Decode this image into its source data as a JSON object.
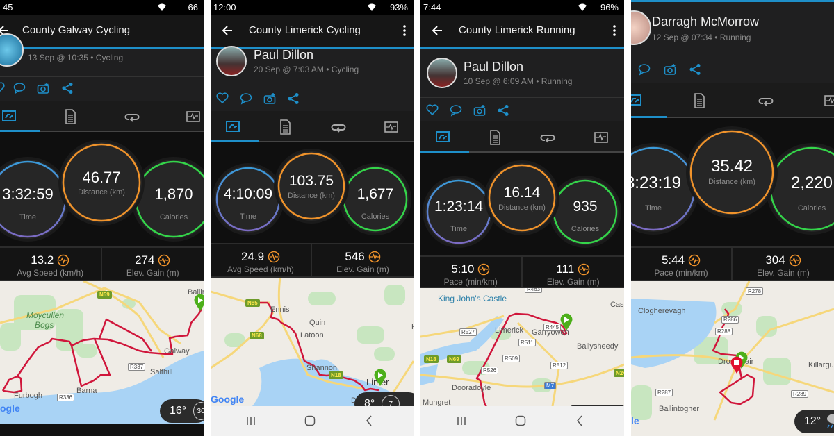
{
  "colors": {
    "accent": "#1e8fc9",
    "time_ring_top": "#3a9ad9",
    "time_ring_bottom": "#7c6bc4",
    "distance_ring": "#f0932b",
    "calories_ring": "#34d54a",
    "route": "#d0163b",
    "start_pin": "#4caf1a",
    "end_pin": "#e0102e"
  },
  "panels": [
    {
      "status": {
        "time": "45",
        "battery": "66"
      },
      "toolbar": {
        "title": "County Galway Cycling"
      },
      "profile": {
        "name": "",
        "subtitle": "13 Sep @ 10:35 • Cycling"
      },
      "tabs": [
        "summary-icon",
        "details-icon",
        "laps-icon",
        "charts-icon"
      ],
      "circles": [
        {
          "value": "3:32:59",
          "label": "Time"
        },
        {
          "value": "46.77",
          "label": "Distance (km)"
        },
        {
          "value": "1,870",
          "label": "Calories"
        }
      ],
      "row": [
        {
          "value": "13.2",
          "label": "Avg Speed (km/h)"
        },
        {
          "value": "274",
          "label": "Elev. Gain (m)"
        }
      ],
      "map": {
        "labels": [
          "Moycullen",
          "Bogs",
          "Galway",
          "Salthill",
          "Barna",
          "Furbogh",
          "Ballin"
        ],
        "shields": [
          "N59",
          "R337",
          "R336"
        ],
        "attribution": "ogle",
        "weather": {
          "temp": "16°",
          "wind": "30"
        }
      }
    },
    {
      "status": {
        "time": "12:00",
        "battery": "93%"
      },
      "toolbar": {
        "title": "County Limerick Cycling"
      },
      "profile": {
        "name": "Paul Dillon",
        "subtitle": "20 Sep @ 7:03 AM • Cycling"
      },
      "tabs": [
        "summary-icon",
        "details-icon",
        "laps-icon",
        "charts-icon"
      ],
      "circles": [
        {
          "value": "4:10:09",
          "label": "Time"
        },
        {
          "value": "103.75",
          "label": "Distance (km)"
        },
        {
          "value": "1,677",
          "label": "Calories"
        }
      ],
      "row": [
        {
          "value": "24.9",
          "label": "Avg Speed (km/h)"
        },
        {
          "value": "546",
          "label": "Elev. Gain (m)"
        }
      ],
      "map": {
        "labels": [
          "Ennis",
          "Quin",
          "Latoon",
          "Shannon",
          "Limer",
          "Kil",
          "Do"
        ],
        "shields": [
          "N85",
          "N68",
          "N18"
        ],
        "attribution": "Google",
        "weather": {
          "temp": "8°",
          "wind": "7"
        }
      }
    },
    {
      "status": {
        "time": "7:44",
        "battery": "96%"
      },
      "toolbar": {
        "title": "County Limerick Running"
      },
      "profile": {
        "name": "Paul Dillon",
        "subtitle": "10 Sep @ 6:09 AM • Running"
      },
      "tabs": [
        "summary-icon",
        "details-icon",
        "laps-icon",
        "charts-icon"
      ],
      "circles": [
        {
          "value": "1:23:14",
          "label": "Time"
        },
        {
          "value": "16.14",
          "label": "Distance (km)"
        },
        {
          "value": "935",
          "label": "Calories"
        }
      ],
      "row": [
        {
          "value": "5:10",
          "label": "Pace (min/km)"
        },
        {
          "value": "111",
          "label": "Elev. Gain (m)"
        }
      ],
      "map": {
        "labels": [
          "King John's Castle",
          "Limerick",
          "Garryowen",
          "Ballysheedy",
          "Dooradoyle",
          "Mungret",
          "Cast"
        ],
        "shields": [
          "R527",
          "R511",
          "R509",
          "R526",
          "R512",
          "M7",
          "N18",
          "N69",
          "N24",
          "R445",
          "R463"
        ],
        "attribution": "",
        "weather": {
          "temp": "",
          "wind": ""
        }
      }
    },
    {
      "status": {
        "time": "",
        "battery": ""
      },
      "toolbar": {
        "title": ""
      },
      "profile": {
        "name": "Darragh McMorrow",
        "subtitle": "12 Sep @ 07:34 • Running"
      },
      "tabs": [
        "summary-icon",
        "details-icon",
        "laps-icon",
        "charts-icon"
      ],
      "circles": [
        {
          "value": "3:23:19",
          "label": "Time"
        },
        {
          "value": "35.42",
          "label": "Distance (km)"
        },
        {
          "value": "2,220",
          "label": "Calories"
        }
      ],
      "row": [
        {
          "value": "5:44",
          "label": "Pace (min/km)"
        },
        {
          "value": "304",
          "label": "Elev. Gain (m)"
        }
      ],
      "map": {
        "labels": [
          "Clogherevagh",
          "Dromahair",
          "Killargu",
          "Ballintogher"
        ],
        "shields": [
          "R278",
          "R286",
          "R288",
          "R287",
          "R289"
        ],
        "attribution": "le",
        "weather": {
          "temp": "12°",
          "wind": ""
        }
      }
    }
  ]
}
